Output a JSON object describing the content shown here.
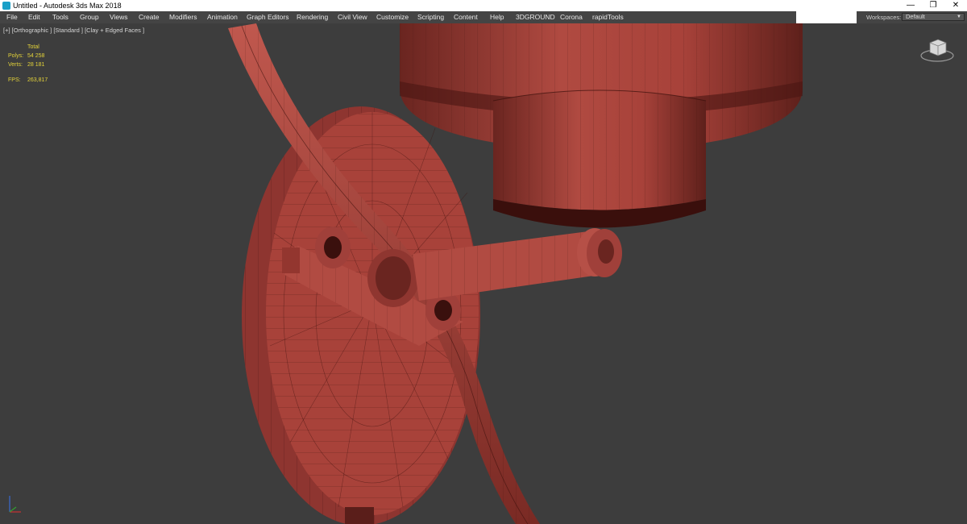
{
  "window": {
    "title": "Untitled - Autodesk 3ds Max 2018",
    "minimize_glyph": "—",
    "maximize_glyph": "❐",
    "close_glyph": "✕"
  },
  "menu": {
    "items": [
      "File",
      "Edit",
      "Tools",
      "Group",
      "Views",
      "Create",
      "Modifiers",
      "Animation",
      "Graph Editors",
      "Rendering",
      "Civil View",
      "Customize",
      "Scripting",
      "Content",
      "Help",
      "3DGROUND",
      "Corona",
      "rapidTools"
    ]
  },
  "workspaces": {
    "label": "Workspaces:",
    "value": "Default"
  },
  "viewport": {
    "label": "[+] [Orthographic ] [Standard ] [Clay + Edged Faces ]",
    "stats": {
      "header": "Total",
      "polys_label": "Polys:",
      "polys_value": "54 258",
      "verts_label": "Verts:",
      "verts_value": "28 181",
      "fps_label": "FPS:",
      "fps_value": "263,817"
    }
  },
  "colors": {
    "viewport_bg": "#3d3d3d",
    "clay": "#a8423a",
    "clay_dark": "#5a1e1a",
    "stats_text": "#e3d23a",
    "menubar_bg": "#444444"
  },
  "icons": {
    "app": "app-icon",
    "viewcube": "viewcube-icon",
    "axis": "axis-tripod-icon"
  }
}
